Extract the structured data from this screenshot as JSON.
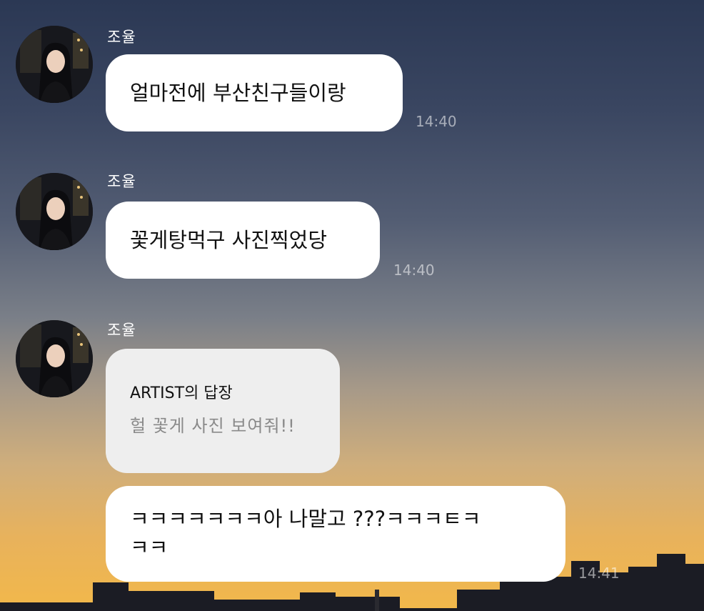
{
  "messages": [
    {
      "sender": "조율",
      "text": "얼마전에 부산친구들이랑",
      "time": "14:40"
    },
    {
      "sender": "조율",
      "text": "꽃게탕먹구 사진찍었당",
      "time": "14:40"
    },
    {
      "sender": "조율",
      "reply": {
        "title": "ARTIST의 답장",
        "text": "헐 꽃게 사진 보여줘!!"
      },
      "text_line1": "ㅋㅋㅋㅋㅋㅋㅋ아 나말고 ???ㅋㅋㅋㅌㅋ",
      "text_line2": "ㅋㅋ",
      "time": "14:41"
    }
  ],
  "colors": {
    "bubble": "#ffffff",
    "reply_bubble": "#eeeeee",
    "sky_top": "#2b3854",
    "sky_bottom": "#f2b84a"
  },
  "icons": {
    "avatar": "profile-photo"
  }
}
